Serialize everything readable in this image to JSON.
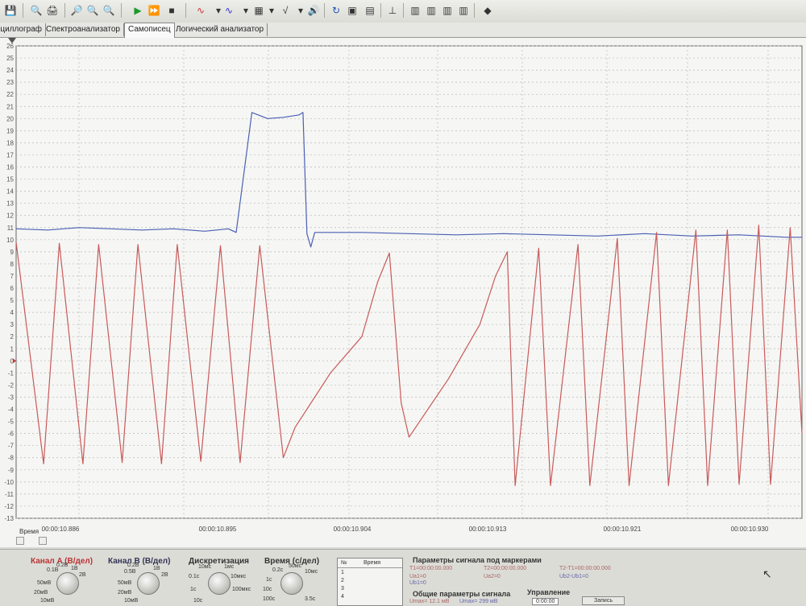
{
  "tabs": [
    {
      "label": "Осциллограф"
    },
    {
      "label": "Спектроанализатор"
    },
    {
      "label": "Самописец"
    },
    {
      "label": "Логический анализатор"
    }
  ],
  "active_tab": "Самописец",
  "chart_data": {
    "type": "line",
    "y_ticks": [
      26,
      25,
      24,
      23,
      22,
      21,
      20,
      19,
      18,
      17,
      16,
      15,
      14,
      13,
      12,
      11,
      10,
      9,
      8,
      7,
      6,
      5,
      4,
      3,
      2,
      1,
      0,
      -1,
      -2,
      -3,
      -4,
      -5,
      -6,
      -7,
      -8,
      -9,
      -10,
      -11,
      -12,
      -13
    ],
    "ylim": [
      -13,
      26
    ],
    "x_label": "Время",
    "x_ticks": [
      "00:00:10.886",
      "00:00:10.895",
      "00:00:10.904",
      "00:00:10.913",
      "00:00:10.921",
      "00:00:10.930"
    ],
    "series": [
      {
        "color": "#4a5fb4",
        "role": "channel-b",
        "points": [
          [
            0,
            10.9
          ],
          [
            4,
            10.8
          ],
          [
            8,
            11.0
          ],
          [
            12,
            10.9
          ],
          [
            16,
            10.8
          ],
          [
            20,
            10.9
          ],
          [
            24,
            10.7
          ],
          [
            27,
            10.9
          ],
          [
            28,
            10.6
          ],
          [
            30,
            20.5
          ],
          [
            32,
            20.0
          ],
          [
            34,
            20.1
          ],
          [
            36,
            20.3
          ],
          [
            36.5,
            20.5
          ],
          [
            37,
            10.5
          ],
          [
            37.5,
            9.4
          ],
          [
            38,
            10.6
          ],
          [
            44,
            10.6
          ],
          [
            50,
            10.5
          ],
          [
            56,
            10.4
          ],
          [
            62,
            10.5
          ],
          [
            68,
            10.4
          ],
          [
            74,
            10.3
          ],
          [
            80,
            10.5
          ],
          [
            86,
            10.3
          ],
          [
            92,
            10.4
          ],
          [
            98,
            10.2
          ],
          [
            100,
            10.2
          ]
        ]
      },
      {
        "color": "#c75a5a",
        "role": "channel-a",
        "points": [
          [
            0,
            9.8
          ],
          [
            3.5,
            -8.5
          ],
          [
            5.5,
            9.7
          ],
          [
            8.5,
            -8.5
          ],
          [
            10.5,
            9.6
          ],
          [
            13.5,
            -8.4
          ],
          [
            15.5,
            9.6
          ],
          [
            18.5,
            -8.5
          ],
          [
            20.5,
            9.6
          ],
          [
            23.5,
            -8.3
          ],
          [
            26,
            9.5
          ],
          [
            28.5,
            -8.4
          ],
          [
            31,
            9.5
          ],
          [
            34,
            -8.0
          ],
          [
            35.5,
            -5.5
          ],
          [
            40,
            -1.0
          ],
          [
            44,
            2.0
          ],
          [
            46,
            6.5
          ],
          [
            47.5,
            8.9
          ],
          [
            49,
            -3.5
          ],
          [
            50,
            -6.3
          ],
          [
            55,
            -1.5
          ],
          [
            59,
            3.0
          ],
          [
            61,
            7.0
          ],
          [
            62.5,
            9.0
          ],
          [
            63.5,
            -10.3
          ],
          [
            66.5,
            9.3
          ],
          [
            68,
            -10.3
          ],
          [
            71.5,
            9.6
          ],
          [
            73,
            -10.3
          ],
          [
            76.5,
            10.1
          ],
          [
            78,
            -10.3
          ],
          [
            81.5,
            10.6
          ],
          [
            83,
            -10.3
          ],
          [
            86.5,
            10.8
          ],
          [
            88,
            -10.3
          ],
          [
            90.5,
            10.8
          ],
          [
            92,
            -10.2
          ],
          [
            94.5,
            11.2
          ],
          [
            96,
            -10.2
          ],
          [
            98.5,
            11.0
          ],
          [
            100,
            -6.0
          ]
        ]
      }
    ]
  },
  "bottom": {
    "channel_a": {
      "title": "Канал A (В/дел)",
      "labels": [
        "0.2В",
        "0.1В",
        "1В",
        "2В",
        "50мВ",
        "20мВ",
        "10мВ"
      ]
    },
    "channel_b": {
      "title": "Канал B (В/дел)",
      "labels": [
        "0.2В",
        "0.5В",
        "1В",
        "2В",
        "50мВ",
        "20мВ",
        "10мВ"
      ]
    },
    "discretization": {
      "title": "Дискретизация",
      "labels": [
        "10мс",
        "0.1с",
        "1мс",
        "1с",
        "10с",
        "10мкс",
        "100мкс"
      ]
    },
    "time": {
      "title": "Время (с/дел)",
      "labels": [
        "0.2с",
        "50мс",
        "1с",
        "10мс",
        "10с",
        "100с",
        "3.5с"
      ]
    },
    "table": {
      "col_no": "№",
      "col_time": "Время",
      "rows": [
        "1",
        "2",
        "3",
        "4"
      ]
    },
    "marker_params": {
      "title": "Параметры сигнала под маркерами",
      "t1": "T1=00:00:00.000",
      "t2": "T2=00:00:00.000",
      "dt": "T2-T1=00:00:00.000",
      "ua": "Ua1=0",
      "ub": "Ub1=0",
      "ua2": "Ua2=0",
      "ub2": "Ub2-Ub1=0"
    },
    "general": {
      "title": "Общие параметры сигнала",
      "umax": "Umax= 12.1 мВ",
      "umax2": "Umax= 299 мВ"
    },
    "control": {
      "title": "Управление",
      "time": "0:00:00",
      "btn": "Запись"
    }
  }
}
